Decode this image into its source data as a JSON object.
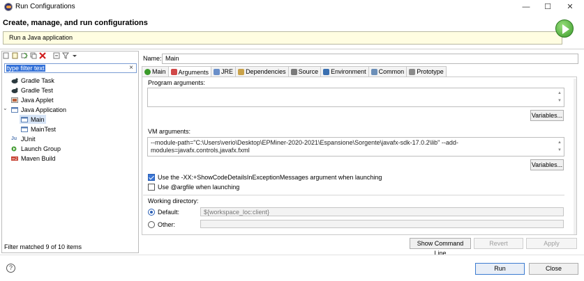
{
  "window": {
    "title": "Run Configurations",
    "minimize": "—",
    "maximize": "☐",
    "close": "✕"
  },
  "header": {
    "title": "Create, manage, and run configurations",
    "description": "Run a Java application"
  },
  "filter": {
    "value": "type filter text",
    "clear_glyph": "×"
  },
  "tree": {
    "items": [
      {
        "label": "Gradle Task",
        "icon": "gradle-icon"
      },
      {
        "label": "Gradle Test",
        "icon": "gradle-icon"
      },
      {
        "label": "Java Applet",
        "icon": "applet-icon"
      },
      {
        "label": "Java Application",
        "icon": "java-app-icon",
        "expanded": true
      },
      {
        "label": "Main",
        "icon": "java-app-icon",
        "selected": true
      },
      {
        "label": "MainTest",
        "icon": "java-app-icon"
      },
      {
        "label": "JUnit",
        "icon": "junit-icon"
      },
      {
        "label": "Launch Group",
        "icon": "launch-group-icon"
      },
      {
        "label": "Maven Build",
        "icon": "maven-icon"
      }
    ],
    "twist": "⌄"
  },
  "status": {
    "filter_text": "Filter matched 9 of 10 items"
  },
  "config": {
    "name_label": "Name:",
    "name_value": "Main",
    "tabs": [
      {
        "label": "Main",
        "color": "#3a9a2a"
      },
      {
        "label": "Arguments",
        "color": "#d04848",
        "active": true
      },
      {
        "label": "JRE",
        "color": "#6a8fc9"
      },
      {
        "label": "Dependencies",
        "color": "#c9a24a"
      },
      {
        "label": "Source",
        "color": "#7a7a7a"
      },
      {
        "label": "Environment",
        "color": "#3a6fb0"
      },
      {
        "label": "Common",
        "color": "#6c8fb8"
      },
      {
        "label": "Prototype",
        "color": "#8a8a8a"
      }
    ],
    "program_args_label": "Program arguments:",
    "program_args_value": "",
    "variables_label": "Variables...",
    "vm_args_label": "VM arguments:",
    "vm_args_line1": "--module-path=\"C:\\Users\\verio\\Desktop\\EPMiner-2020-2021\\Espansione\\Sorgente\\javafx-sdk-17.0.2\\lib\" --add-",
    "vm_args_line2": "modules=javafx.controls,javafx.fxml",
    "show_code_details_label": "Use the -XX:+ShowCodeDetailsInExceptionMessages argument when launching",
    "argfile_label": "Use @argfile when launching",
    "working_dir_label": "Working directory:",
    "default_label": "Default:",
    "default_value": "${workspace_loc:client}",
    "other_label": "Other:",
    "other_value": ""
  },
  "buttons": {
    "show_command_line": "Show Command Line",
    "revert": "Revert",
    "apply": "Apply",
    "run": "Run",
    "close": "Close",
    "help": "?"
  }
}
